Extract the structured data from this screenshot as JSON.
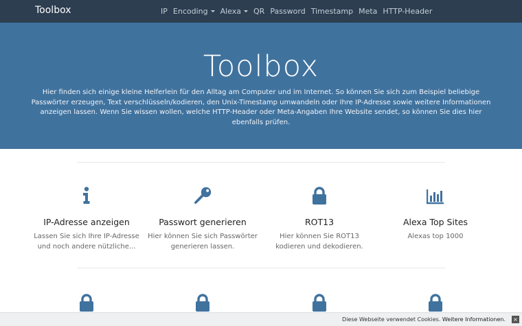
{
  "navbar": {
    "brand": "Toolbox",
    "items": [
      {
        "label": "IP"
      },
      {
        "label": "Encoding"
      },
      {
        "label": "Alexa"
      },
      {
        "label": "QR"
      },
      {
        "label": "Password"
      },
      {
        "label": "Timestamp"
      },
      {
        "label": "Meta"
      },
      {
        "label": "HTTP-Header"
      }
    ]
  },
  "hero": {
    "title": "Toolbox",
    "intro": "Hier finden sich einige kleine Helferlein für den Alltag am Computer und im Internet. So können Sie sich zum Beispiel beliebige Passwörter erzeugen, Text verschlüsseln/kodieren, den Unix-Timestamp umwandeln oder Ihre IP-Adresse sowie weitere Informationen anzeigen lassen. Wenn Sie wissen wollen, welche HTTP-Header oder Meta-Angaben Ihre Website sendet, so können Sie dies hier ebenfalls prüfen."
  },
  "features": [
    {
      "icon": "info-icon",
      "title": "IP-Adresse anzeigen",
      "desc": "Lassen Sie sich Ihre IP-Adresse und noch andere nützliche..."
    },
    {
      "icon": "key-icon",
      "title": "Passwort generieren",
      "desc": "Hier können Sie sich Passwörter generieren lassen."
    },
    {
      "icon": "lock-icon",
      "title": "ROT13",
      "desc": "Hier können Sie ROT13 kodieren und dekodieren."
    },
    {
      "icon": "bar-chart-icon",
      "title": "Alexa Top Sites",
      "desc": "Alexas top 1000"
    }
  ],
  "cookie": {
    "text": "Diese Webseite verwendet Cookies.",
    "link": "Weitere Informationen.",
    "close": "×"
  },
  "colors": {
    "navbar_bg": "#2c3e50",
    "hero_bg": "#40729e",
    "icon": "#40729e"
  }
}
